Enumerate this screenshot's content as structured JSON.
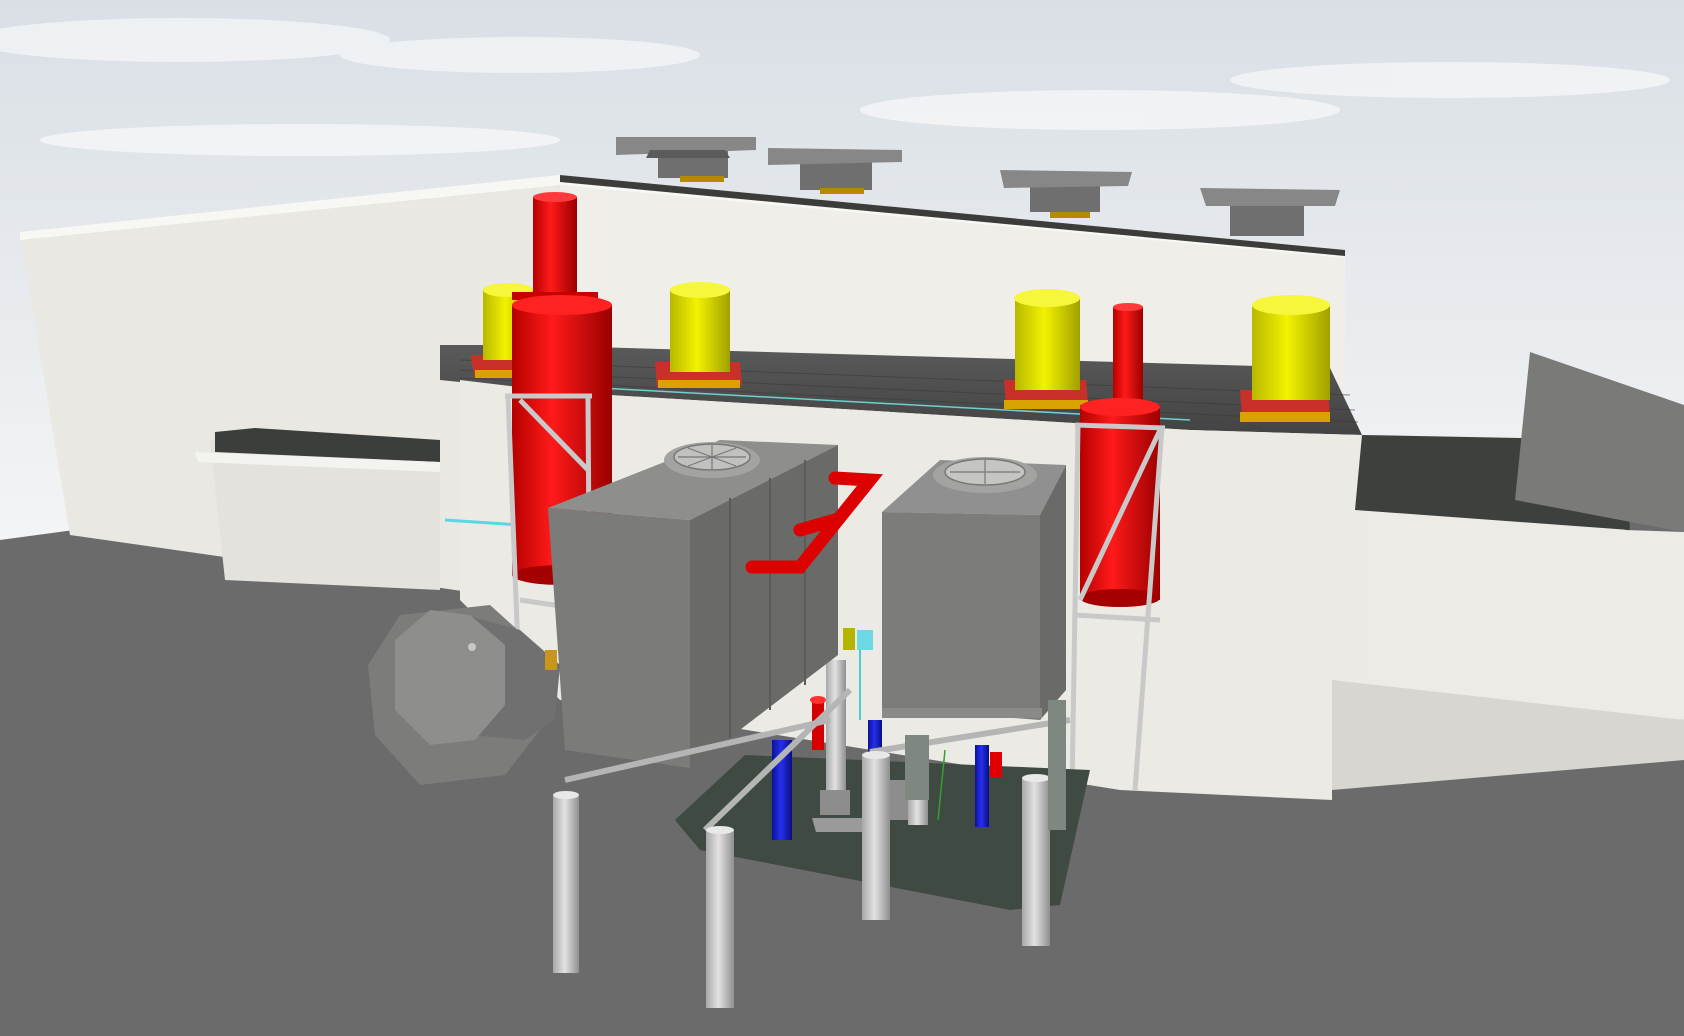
{
  "viewport": {
    "type": "3d-model-view",
    "text_content": []
  },
  "colors": {
    "sky_top": "#dfe4e9",
    "sky_bottom": "#f3f5f6",
    "ground": "#6a6a6a",
    "wall": "#ecebe6",
    "wall_shadow": "#d3d2cc",
    "roof_dark": "#3d3f3d",
    "grating": "#4d4d4d",
    "chiller_casing": "#7d7d7b",
    "chiller_dark": "#5f5f5d",
    "fan_grille": "#9b9b99",
    "support_leg": "#cfcfcf",
    "exhaust_stack": "#e00000",
    "exhaust_stack_shade": "#a40000",
    "roof_fan": "#e4e400",
    "roof_fan_shade": "#a9a900",
    "fan_base": "#c9302a",
    "fan_base_trim": "#d8a200",
    "chilled_water_pipe": "#1520c8",
    "condenser_pipe": "#d40000",
    "pad": "#3e4b43",
    "accent_cyan": "#58d8e0",
    "vent_cap": "#7f7f7f"
  },
  "components": {
    "roof_vents": [
      "roof-vent-cap",
      "roof-vent-cap",
      "roof-vent-cap",
      "roof-vent-cap"
    ],
    "roof_fans": [
      "exhaust-fan",
      "exhaust-fan",
      "exhaust-fan",
      "exhaust-fan"
    ],
    "exhaust_stacks": [
      "boiler-exhaust-stack-left",
      "boiler-exhaust-stack-right"
    ],
    "cooling_units": [
      "cooling-tower-left",
      "cooling-tower-right"
    ],
    "pumps": [
      "chilled-water-pump",
      "condenser-water-pump"
    ]
  }
}
